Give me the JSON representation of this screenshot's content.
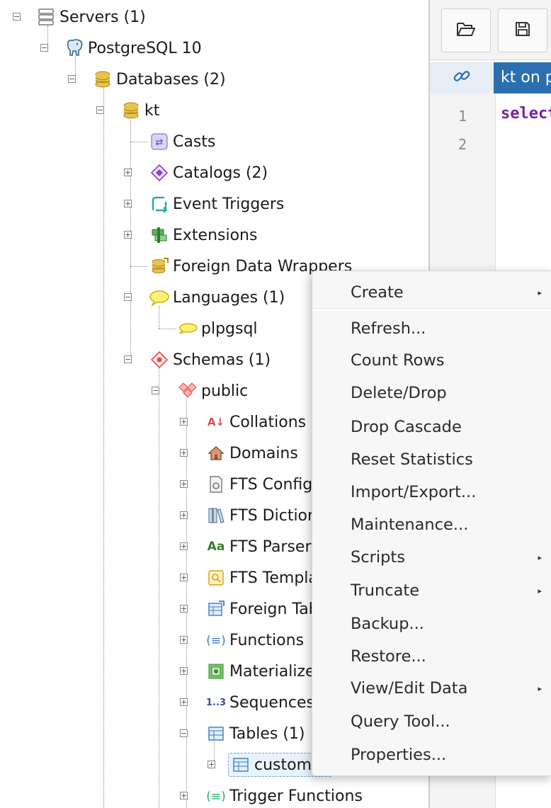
{
  "tree": {
    "servers": "Servers (1)",
    "postgres": "PostgreSQL 10",
    "databases": "Databases (2)",
    "kt": "kt",
    "casts": "Casts",
    "catalogs": "Catalogs (2)",
    "event_triggers": "Event Triggers",
    "extensions": "Extensions",
    "fdw": "Foreign Data Wrappers",
    "languages": "Languages (1)",
    "plpgsql": "plpgsql",
    "schemas": "Schemas (1)",
    "public": "public",
    "collations": "Collations",
    "domains": "Domains",
    "fts_config": "FTS Configurations",
    "fts_dict": "FTS Dictionaries",
    "fts_parsers": "FTS Parsers",
    "fts_templates": "FTS Templates",
    "foreign_tables": "Foreign Tables",
    "functions": "Functions",
    "matviews": "Materialized Views",
    "sequences": "Sequences",
    "tables": "Tables (1)",
    "customer": "customer",
    "trigger_functions": "Trigger Functions"
  },
  "icons": {
    "sequences_glyph": "1..3",
    "fts_parsers_glyph": "Aa",
    "collation_glyph": "A↓"
  },
  "editor": {
    "tab_label": "kt on postgres",
    "line_numbers": [
      "1",
      "2"
    ],
    "code_line": "select"
  },
  "context_menu": {
    "items": [
      {
        "label": "Create",
        "submenu": true
      },
      {
        "label": "Refresh...",
        "submenu": false
      },
      {
        "label": "Count Rows",
        "submenu": false
      },
      {
        "label": "Delete/Drop",
        "submenu": false
      },
      {
        "label": "Drop Cascade",
        "submenu": false
      },
      {
        "label": "Reset Statistics",
        "submenu": false
      },
      {
        "label": "Import/Export...",
        "submenu": false
      },
      {
        "label": "Maintenance...",
        "submenu": false
      },
      {
        "label": "Scripts",
        "submenu": true
      },
      {
        "label": "Truncate",
        "submenu": true
      },
      {
        "label": "Backup...",
        "submenu": false
      },
      {
        "label": "Restore...",
        "submenu": false
      },
      {
        "label": "View/Edit Data",
        "submenu": true
      },
      {
        "label": "Query Tool...",
        "submenu": false
      },
      {
        "label": "Properties...",
        "submenu": false
      }
    ]
  },
  "colors": {
    "accent": "#2c6fb0",
    "code_keyword": "#7a1fa2",
    "selection": "#e9f3fc"
  }
}
